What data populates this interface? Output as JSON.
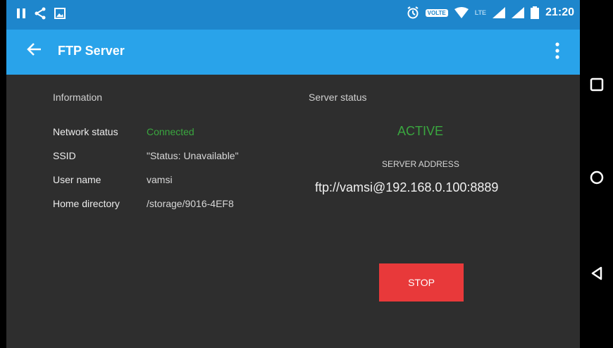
{
  "statusbar": {
    "time": "21:20",
    "volte_label": "VOLTE",
    "lte_label": "LTE",
    "icons": [
      "pause-icon",
      "share-icon",
      "image-icon",
      "alarm-icon",
      "volte-badge",
      "wifi-icon",
      "lte-label",
      "signal-icon",
      "signal-icon-2",
      "battery-icon"
    ]
  },
  "appbar": {
    "title": "FTP Server",
    "back_icon": "arrow-left-icon",
    "menu_icon": "more-vertical-icon"
  },
  "information": {
    "title": "Information",
    "rows": [
      {
        "label": "Network status",
        "value": "Connected"
      },
      {
        "label": "SSID",
        "value": "\"Status: Unavailable\""
      },
      {
        "label": "User name",
        "value": "vamsi"
      },
      {
        "label": "Home directory",
        "value": "/storage/9016-4EF8"
      }
    ]
  },
  "server_status": {
    "title": "Server status",
    "state": "ACTIVE",
    "address_label": "SERVER ADDRESS",
    "address": "ftp://vamsi@192.168.0.100:8889",
    "stop_label": "STOP"
  },
  "colors": {
    "statusbar": "#1e86cc",
    "appbar": "#29a3ea",
    "background": "#2e2e2e",
    "active_green": "#3aa63f",
    "stop_red": "#e8393a"
  },
  "navbar": {
    "icons": [
      "recents-square-icon",
      "home-circle-icon",
      "back-triangle-icon"
    ]
  }
}
